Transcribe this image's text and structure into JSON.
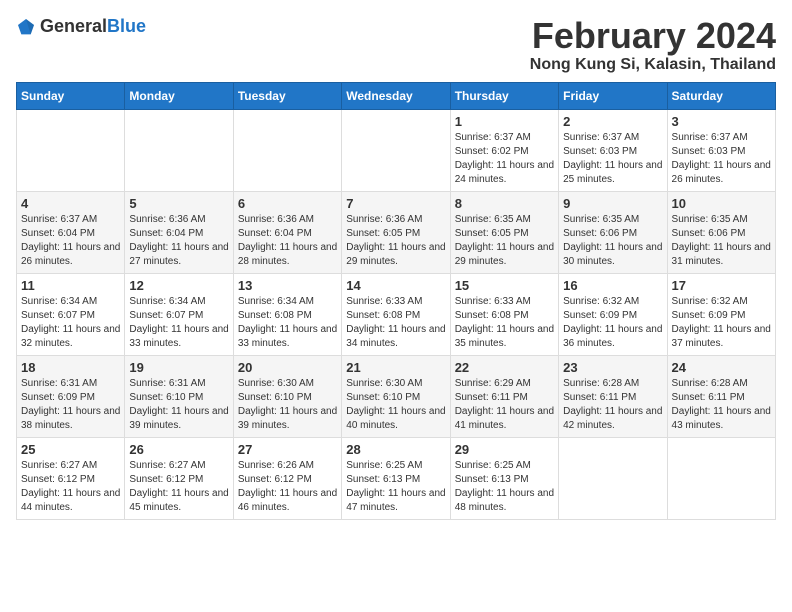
{
  "header": {
    "logo_general": "General",
    "logo_blue": "Blue",
    "month_title": "February 2024",
    "location": "Nong Kung Si, Kalasin, Thailand"
  },
  "days_of_week": [
    "Sunday",
    "Monday",
    "Tuesday",
    "Wednesday",
    "Thursday",
    "Friday",
    "Saturday"
  ],
  "weeks": [
    [
      {
        "day": "",
        "info": ""
      },
      {
        "day": "",
        "info": ""
      },
      {
        "day": "",
        "info": ""
      },
      {
        "day": "",
        "info": ""
      },
      {
        "day": "1",
        "info": "Sunrise: 6:37 AM\nSunset: 6:02 PM\nDaylight: 11 hours and 24 minutes."
      },
      {
        "day": "2",
        "info": "Sunrise: 6:37 AM\nSunset: 6:03 PM\nDaylight: 11 hours and 25 minutes."
      },
      {
        "day": "3",
        "info": "Sunrise: 6:37 AM\nSunset: 6:03 PM\nDaylight: 11 hours and 26 minutes."
      }
    ],
    [
      {
        "day": "4",
        "info": "Sunrise: 6:37 AM\nSunset: 6:04 PM\nDaylight: 11 hours and 26 minutes."
      },
      {
        "day": "5",
        "info": "Sunrise: 6:36 AM\nSunset: 6:04 PM\nDaylight: 11 hours and 27 minutes."
      },
      {
        "day": "6",
        "info": "Sunrise: 6:36 AM\nSunset: 6:04 PM\nDaylight: 11 hours and 28 minutes."
      },
      {
        "day": "7",
        "info": "Sunrise: 6:36 AM\nSunset: 6:05 PM\nDaylight: 11 hours and 29 minutes."
      },
      {
        "day": "8",
        "info": "Sunrise: 6:35 AM\nSunset: 6:05 PM\nDaylight: 11 hours and 29 minutes."
      },
      {
        "day": "9",
        "info": "Sunrise: 6:35 AM\nSunset: 6:06 PM\nDaylight: 11 hours and 30 minutes."
      },
      {
        "day": "10",
        "info": "Sunrise: 6:35 AM\nSunset: 6:06 PM\nDaylight: 11 hours and 31 minutes."
      }
    ],
    [
      {
        "day": "11",
        "info": "Sunrise: 6:34 AM\nSunset: 6:07 PM\nDaylight: 11 hours and 32 minutes."
      },
      {
        "day": "12",
        "info": "Sunrise: 6:34 AM\nSunset: 6:07 PM\nDaylight: 11 hours and 33 minutes."
      },
      {
        "day": "13",
        "info": "Sunrise: 6:34 AM\nSunset: 6:08 PM\nDaylight: 11 hours and 33 minutes."
      },
      {
        "day": "14",
        "info": "Sunrise: 6:33 AM\nSunset: 6:08 PM\nDaylight: 11 hours and 34 minutes."
      },
      {
        "day": "15",
        "info": "Sunrise: 6:33 AM\nSunset: 6:08 PM\nDaylight: 11 hours and 35 minutes."
      },
      {
        "day": "16",
        "info": "Sunrise: 6:32 AM\nSunset: 6:09 PM\nDaylight: 11 hours and 36 minutes."
      },
      {
        "day": "17",
        "info": "Sunrise: 6:32 AM\nSunset: 6:09 PM\nDaylight: 11 hours and 37 minutes."
      }
    ],
    [
      {
        "day": "18",
        "info": "Sunrise: 6:31 AM\nSunset: 6:09 PM\nDaylight: 11 hours and 38 minutes."
      },
      {
        "day": "19",
        "info": "Sunrise: 6:31 AM\nSunset: 6:10 PM\nDaylight: 11 hours and 39 minutes."
      },
      {
        "day": "20",
        "info": "Sunrise: 6:30 AM\nSunset: 6:10 PM\nDaylight: 11 hours and 39 minutes."
      },
      {
        "day": "21",
        "info": "Sunrise: 6:30 AM\nSunset: 6:10 PM\nDaylight: 11 hours and 40 minutes."
      },
      {
        "day": "22",
        "info": "Sunrise: 6:29 AM\nSunset: 6:11 PM\nDaylight: 11 hours and 41 minutes."
      },
      {
        "day": "23",
        "info": "Sunrise: 6:28 AM\nSunset: 6:11 PM\nDaylight: 11 hours and 42 minutes."
      },
      {
        "day": "24",
        "info": "Sunrise: 6:28 AM\nSunset: 6:11 PM\nDaylight: 11 hours and 43 minutes."
      }
    ],
    [
      {
        "day": "25",
        "info": "Sunrise: 6:27 AM\nSunset: 6:12 PM\nDaylight: 11 hours and 44 minutes."
      },
      {
        "day": "26",
        "info": "Sunrise: 6:27 AM\nSunset: 6:12 PM\nDaylight: 11 hours and 45 minutes."
      },
      {
        "day": "27",
        "info": "Sunrise: 6:26 AM\nSunset: 6:12 PM\nDaylight: 11 hours and 46 minutes."
      },
      {
        "day": "28",
        "info": "Sunrise: 6:25 AM\nSunset: 6:13 PM\nDaylight: 11 hours and 47 minutes."
      },
      {
        "day": "29",
        "info": "Sunrise: 6:25 AM\nSunset: 6:13 PM\nDaylight: 11 hours and 48 minutes."
      },
      {
        "day": "",
        "info": ""
      },
      {
        "day": "",
        "info": ""
      }
    ]
  ]
}
